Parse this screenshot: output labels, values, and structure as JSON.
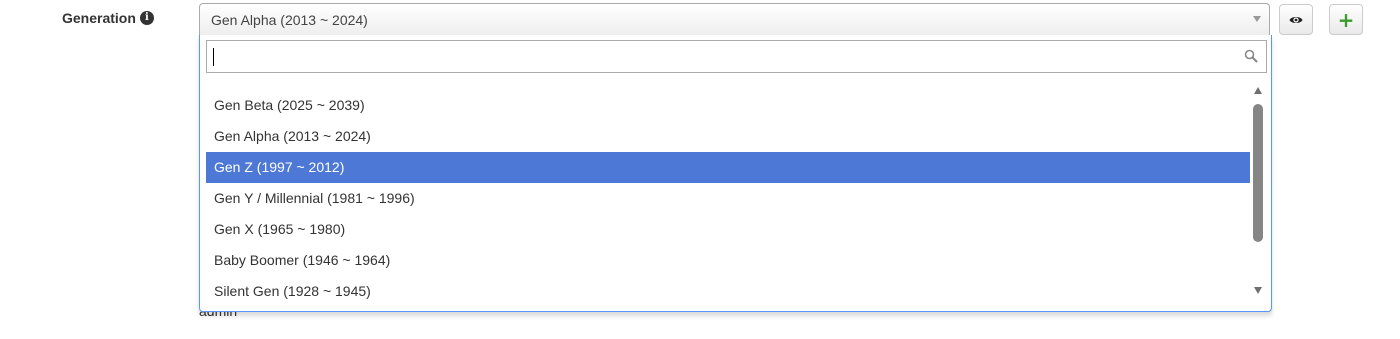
{
  "field": {
    "label": "Generation",
    "info_icon": "info-circle-icon"
  },
  "select": {
    "value": "Gen Alpha (2013 ~ 2024)",
    "arrow_icon": "triangle-down-icon"
  },
  "buttons": {
    "view_icon": "eye-icon",
    "add_icon": "plus-icon",
    "add_color": "#3c9a2e"
  },
  "dropdown": {
    "search_value": "",
    "search_icon": "search-icon",
    "highlight_color": "#4e78d6",
    "options": [
      {
        "label": "Gen Beta (2025 ~ 2039)",
        "highlighted": false
      },
      {
        "label": "Gen Alpha (2013 ~ 2024)",
        "highlighted": false
      },
      {
        "label": "Gen Z (1997 ~ 2012)",
        "highlighted": true
      },
      {
        "label": "Gen Y / Millennial (1981 ~ 1996)",
        "highlighted": false
      },
      {
        "label": "Gen X (1965 ~ 1980)",
        "highlighted": false
      },
      {
        "label": "Baby Boomer (1946 ~ 1964)",
        "highlighted": false
      },
      {
        "label": "Silent Gen (1928 ~ 1945)",
        "highlighted": false
      }
    ]
  },
  "background": {
    "partial_text": "admin"
  }
}
